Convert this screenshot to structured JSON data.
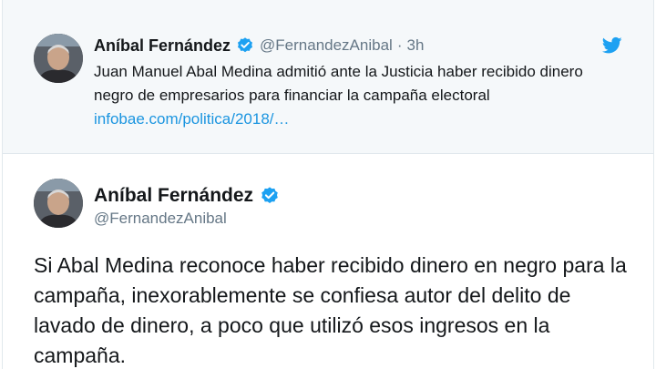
{
  "quoted_tweet": {
    "author_name": "Aníbal Fernández",
    "handle": "@FernandezAnibal",
    "separator": "·",
    "time": "3h",
    "text": "Juan Manuel Abal Medina admitió ante la Justicia haber recibido dinero negro de empresarios para financiar la campaña electoral",
    "link": "infobae.com/politica/2018/…",
    "icons": [
      "avatar",
      "verified-badge-icon",
      "twitter-bird-icon"
    ]
  },
  "main_tweet": {
    "author_name": "Aníbal Fernández",
    "handle": "@FernandezAnibal",
    "text": "Si Abal Medina reconoce haber recibido dinero en negro para la campaña, inexorablemente se confiesa autor del delito de lavado de dinero, a poco que utilizó esos ingresos en la campaña.",
    "icons": [
      "avatar",
      "verified-badge-icon"
    ]
  },
  "colors": {
    "verified_blue": "#1da1f2",
    "link_blue": "#1b95e0",
    "quoted_bg": "#f5f8fa",
    "text": "#14171a",
    "muted": "#657786"
  }
}
